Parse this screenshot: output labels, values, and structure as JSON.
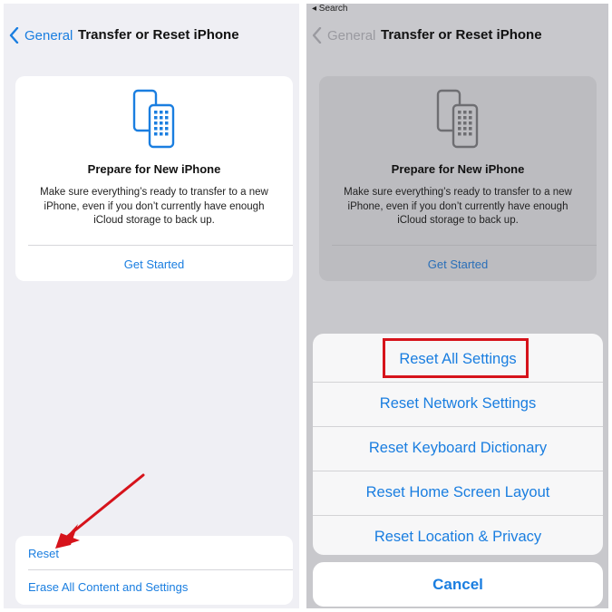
{
  "left": {
    "nav": {
      "back_label": "General",
      "title": "Transfer or Reset iPhone"
    },
    "card": {
      "title": "Prepare for New iPhone",
      "description": "Make sure everything’s ready to transfer to a new iPhone, even if you don’t currently have enough iCloud storage to back up.",
      "action": "Get Started",
      "icon": "phones-transfer-icon"
    },
    "list": {
      "reset": "Reset",
      "erase": "Erase All Content and Settings"
    },
    "annotation": {
      "color": "#d6131b"
    }
  },
  "right": {
    "status_back": "◂ Search",
    "nav": {
      "back_label": "General",
      "title": "Transfer or Reset iPhone"
    },
    "card": {
      "title": "Prepare for New iPhone",
      "description": "Make sure everything’s ready to transfer to a new iPhone, even if you don’t currently have enough iCloud storage to back up.",
      "action": "Get Started"
    },
    "sheet": {
      "options": [
        "Reset All Settings",
        "Reset Network Settings",
        "Reset Keyboard Dictionary",
        "Reset Home Screen Layout",
        "Reset Location & Privacy"
      ],
      "cancel": "Cancel",
      "highlight_color": "#d6131b"
    }
  },
  "colors": {
    "accent": "#1a7ee0",
    "dimmed_background": "#c8c8cc",
    "grouped_background": "#efeff4"
  }
}
